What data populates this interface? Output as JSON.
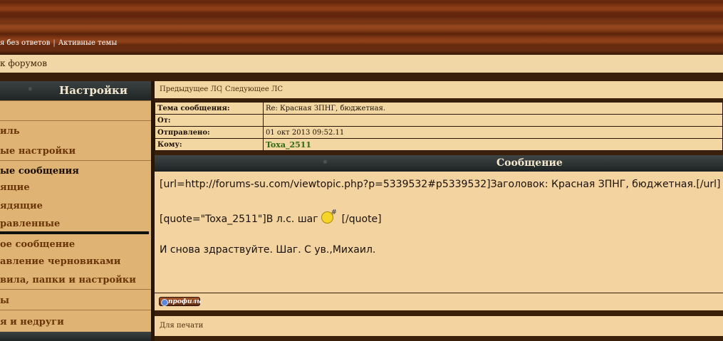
{
  "header": {
    "links": [
      "я без ответов",
      "Активные темы"
    ]
  },
  "crumb": {
    "label": "к форумов"
  },
  "sidebar": {
    "title": "Настройки",
    "items": [
      {
        "label": "иль"
      },
      {
        "label": "ые настройки"
      },
      {
        "label": "ые сообщения"
      },
      {
        "label": "ящие"
      },
      {
        "label": "ядящие"
      },
      {
        "label": "равленные"
      },
      {
        "label": "ое сообщение"
      },
      {
        "label": "авление черновиками"
      },
      {
        "label": "вила, папки и настройки"
      },
      {
        "label": "ы"
      },
      {
        "label": "я и недруги"
      }
    ]
  },
  "pm_nav": {
    "prev": "Предыдущее ЛС",
    "next": "Следующее ЛС"
  },
  "meta": {
    "subject_label": "Тема сообщения:",
    "subject_value": "Re: Красная ЗПНГ, бюджетная.",
    "from_label": "От:",
    "from_value": "",
    "sent_label": "Отправлено:",
    "sent_value": "01 окт 2013 09:52.11",
    "to_label": "Кому:",
    "to_value": "Toxa_2511"
  },
  "message": {
    "heading": "Сообщение",
    "line1": "[url=http://forums-su.com/viewtopic.php?p=5339532#p5339532]Заголовок: Красная ЗПНГ, бюджетная.[/url]",
    "line2_start": "[quote=\"Toxa_2511\"]В л.с. шаг",
    "line2_end": "[/quote]",
    "line3": "И снова здраствуйте. Шаг. С ув.,Михаил."
  },
  "profile_button": "профиль",
  "print_link": "Для печати",
  "colors": {
    "panel": "#f3d4a0",
    "sidebar": "#dfb374",
    "dark_header": "#2b3030",
    "accent_link": "#6a3507",
    "recipient": "#2b6b12"
  }
}
